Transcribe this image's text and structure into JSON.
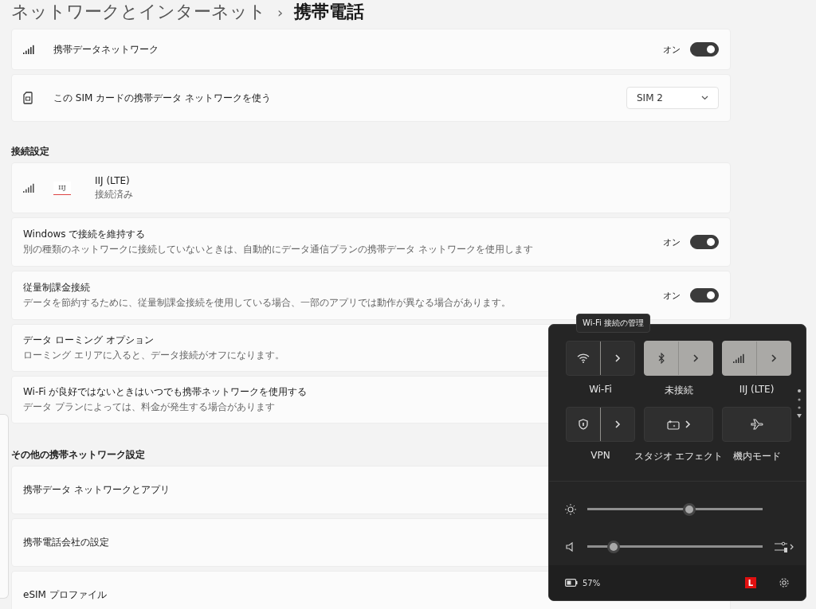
{
  "breadcrumb": {
    "parent": "ネットワークとインターネット",
    "separator": "›",
    "current": "携帯電話"
  },
  "top_rows": [
    {
      "kind": "toggle",
      "label": "携帯データネットワーク",
      "state_text": "オン",
      "on": true
    },
    {
      "kind": "select",
      "label": "この SIM カードの携帯データ ネットワークを使う",
      "value": "SIM 2"
    }
  ],
  "sections": [
    {
      "title": "接続設定",
      "rows": [
        {
          "kind": "carrier",
          "logo_text": "IIJ",
          "label": "IIJ (LTE)",
          "description": "接続済み"
        },
        {
          "kind": "toggle",
          "label": "Windows で接続を維持する",
          "description": "別の種類のネットワークに接続していないときは、自動的にデータ通信プランの携帯データ ネットワークを使用します",
          "state_text": "オン",
          "on": true
        },
        {
          "kind": "toggle",
          "label": "従量制課金接続",
          "description": "データを節約するために、従量制課金接続を使用している場合、一部のアプリでは動作が異なる場合があります。",
          "state_text": "オン",
          "on": true
        },
        {
          "kind": "plain",
          "label": "データ ローミング オプション",
          "description": "ローミング エリアに入ると、データ接続がオフになります。"
        },
        {
          "kind": "plain",
          "label": "Wi-Fi が良好ではないときはいつでも携帯ネットワークを使用する",
          "description": "データ プランによっては、料金が発生する場合があります"
        }
      ]
    },
    {
      "title": "その他の携帯ネットワーク設定",
      "rows": [
        {
          "kind": "plain",
          "label": "携帯データ ネットワークとアプリ"
        },
        {
          "kind": "plain",
          "label": "携帯電話会社の設定"
        },
        {
          "kind": "plain",
          "label": "eSIM プロファイル"
        }
      ]
    }
  ],
  "quick_settings": {
    "tooltip": "Wi-Fi 接続の管理",
    "tiles": [
      {
        "label": "Wi-Fi",
        "on": false
      },
      {
        "label": "未接続",
        "on": true
      },
      {
        "label": "IIJ (LTE)",
        "on": true
      },
      {
        "label": "VPN",
        "on": false
      },
      {
        "label": "スタジオ エフェクト",
        "on": false
      },
      {
        "label": "機内モード",
        "on": false
      }
    ],
    "sliders": [
      {
        "kind": "brightness",
        "level": 0.58
      },
      {
        "kind": "volume",
        "level": 0.15
      }
    ],
    "battery": "57%",
    "badge": "L"
  }
}
